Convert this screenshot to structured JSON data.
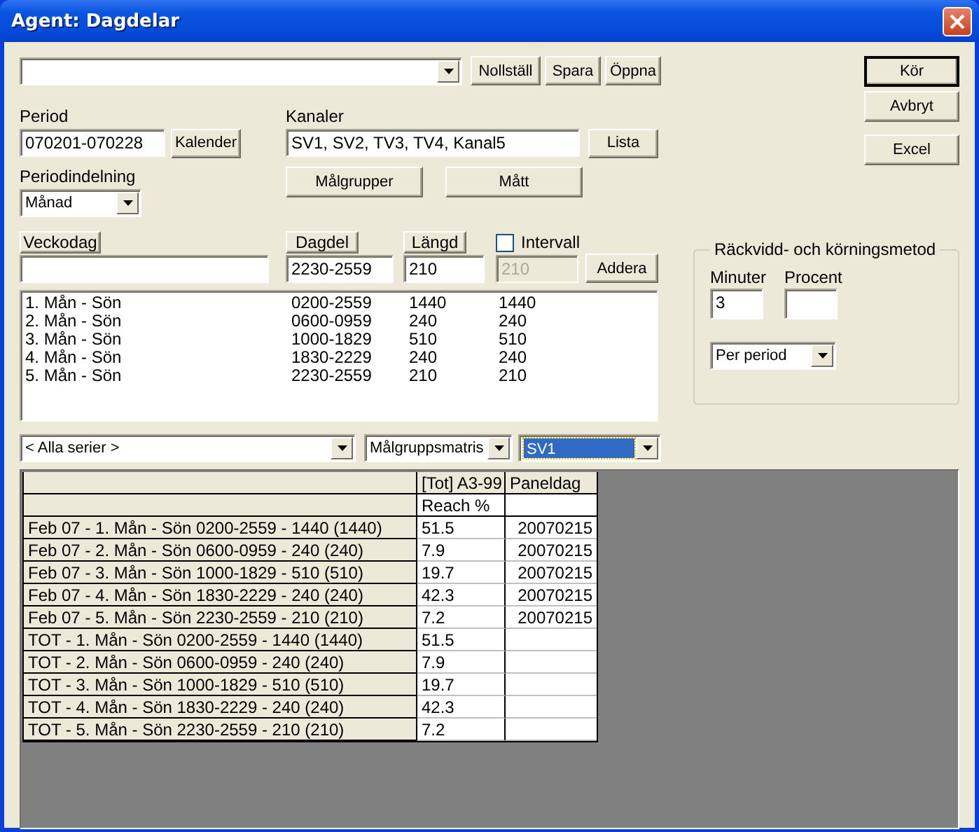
{
  "window": {
    "title": "Agent: Dagdelar"
  },
  "top_buttons": [
    "Nollställ",
    "Spara",
    "Öppna"
  ],
  "action_buttons": [
    {
      "label": "Kör",
      "default": true
    },
    {
      "label": "Avbryt",
      "default": false
    },
    {
      "label": "Excel",
      "default": false
    }
  ],
  "period": {
    "label": "Period",
    "value": "070201-070228",
    "button": "Kalender"
  },
  "periodindelning": {
    "label": "Periodindelning",
    "value": "Månad"
  },
  "kanaler": {
    "label": "Kanaler",
    "value": "SV1, SV2, TV3, TV4, Kanal5",
    "button": "Lista"
  },
  "mid_buttons": [
    "Målgrupper",
    "Mått"
  ],
  "daypart_editor": {
    "veckodag": {
      "label": "Veckodag"
    },
    "dagdel": {
      "label": "Dagdel",
      "value": "2230-2559"
    },
    "langd": {
      "label": "Längd",
      "value": "210"
    },
    "intervall": {
      "label": "Intervall",
      "checked": false,
      "value": "210",
      "disabled": true
    },
    "add_button": "Addera"
  },
  "dayparts": [
    {
      "day": "1. Mån - Sön",
      "time": "0200-2559",
      "length": "1440",
      "interval": "1440"
    },
    {
      "day": "2. Mån - Sön",
      "time": "0600-0959",
      "length": "240",
      "interval": "240"
    },
    {
      "day": "3. Mån - Sön",
      "time": "1000-1829",
      "length": "510",
      "interval": "510"
    },
    {
      "day": "4. Mån - Sön",
      "time": "1830-2229",
      "length": "240",
      "interval": "240"
    },
    {
      "day": "5. Mån - Sön",
      "time": "2230-2559",
      "length": "210",
      "interval": "210"
    }
  ],
  "reach_group": {
    "title": "Räckvidd- och körningsmetod",
    "minuter": {
      "label": "Minuter",
      "value": "3"
    },
    "procent": {
      "label": "Procent"
    },
    "method": "Per period"
  },
  "filters": [
    {
      "value": "< Alla serier >",
      "selected": false
    },
    {
      "value": "Målgruppsmatris",
      "selected": false
    },
    {
      "value": "SV1",
      "selected": true
    }
  ],
  "grid": {
    "columns": [
      {
        "label": "[Tot] A3-99",
        "subheader": "Reach %"
      },
      {
        "label": "Paneldag"
      }
    ],
    "rows": [
      {
        "label": "Feb 07 - 1. Mån - Sön 0200-2559 - 1440 (1440)",
        "values": [
          "51.5",
          "20070215"
        ]
      },
      {
        "label": "Feb 07 - 2. Mån - Sön 0600-0959 - 240 (240)",
        "values": [
          "7.9",
          "20070215"
        ]
      },
      {
        "label": "Feb 07 - 3. Mån - Sön 1000-1829 - 510 (510)",
        "values": [
          "19.7",
          "20070215"
        ]
      },
      {
        "label": "Feb 07 - 4. Mån - Sön 1830-2229 - 240 (240)",
        "values": [
          "42.3",
          "20070215"
        ]
      },
      {
        "label": "Feb 07 - 5. Mån - Sön 2230-2559 - 210 (210)",
        "values": [
          "7.2",
          "20070215"
        ]
      },
      {
        "label": "TOT - 1. Mån - Sön 0200-2559 - 1440 (1440)",
        "values": [
          "51.5"
        ]
      },
      {
        "label": "TOT - 2. Mån - Sön 0600-0959 - 240 (240)",
        "values": [
          "7.9"
        ]
      },
      {
        "label": "TOT - 3. Mån - Sön 1000-1829 - 510 (510)",
        "values": [
          "19.7"
        ]
      },
      {
        "label": "TOT - 4. Mån - Sön 1830-2229 - 240 (240)",
        "values": [
          "42.3"
        ]
      },
      {
        "label": "TOT - 5. Mån - Sön 2230-2559 - 210 (210)",
        "values": [
          "7.2"
        ]
      }
    ]
  }
}
